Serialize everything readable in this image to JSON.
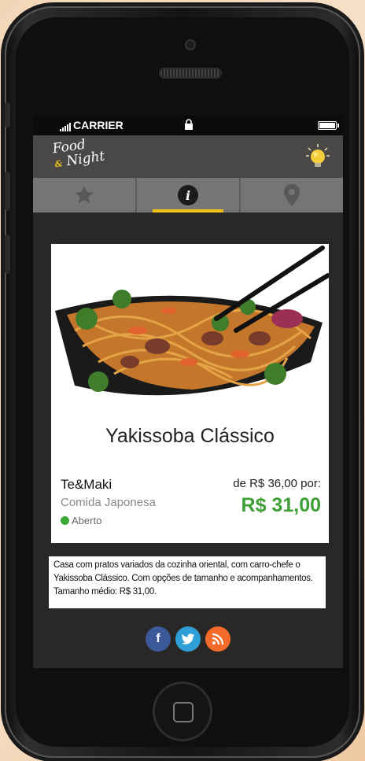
{
  "status_bar": {
    "carrier": "CARRIER"
  },
  "app": {
    "logo_line1": "Food",
    "logo_line2": "Night",
    "logo_mark": "&"
  },
  "tabs": [
    {
      "icon": "star-icon",
      "active": false
    },
    {
      "icon": "info-icon",
      "glyph": "i",
      "active": true
    },
    {
      "icon": "location-pin-icon",
      "active": false
    }
  ],
  "dish": {
    "title": "Yakissoba Clássico",
    "restaurant": "Te&Maki",
    "category": "Comida Japonesa",
    "status": "Aberto",
    "price_old": "de R$ 36,00 por:",
    "price_new": "R$ 31,00"
  },
  "description": "Casa com pratos variados da cozinha oriental, com carro-chefe o Yakissoba Clássico. Com opções de tamanho e acompanhamentos. Tamanho médio: R$ 31,00.",
  "social": [
    {
      "name": "facebook",
      "glyph": "f",
      "color": "#3b5998"
    },
    {
      "name": "twitter",
      "glyph": "t",
      "color": "#2f9fd8"
    },
    {
      "name": "rss",
      "glyph": "rss",
      "color": "#f26b2a"
    }
  ],
  "colors": {
    "accent": "#f2c318",
    "price": "#3d9f35",
    "status_open": "#3aa935"
  }
}
